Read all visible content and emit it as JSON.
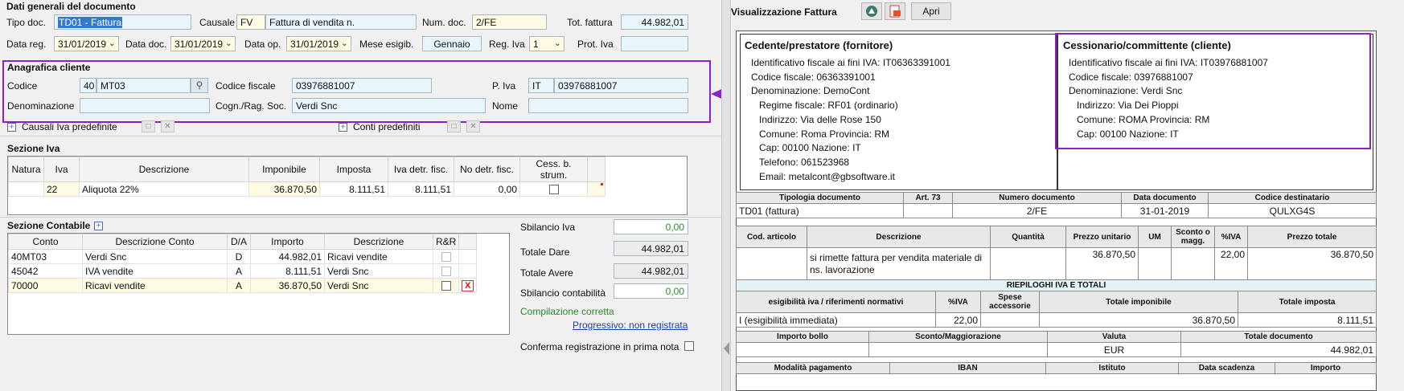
{
  "header": {
    "section_title": "Dati generali del documento",
    "tipo_doc_label": "Tipo doc.",
    "tipo_doc_value": "TD01 - Fattura",
    "causale_label": "Causale",
    "causale_code": "FV",
    "causale_desc": "Fattura di vendita n.",
    "num_doc_label": "Num. doc.",
    "num_doc_value": "2/FE",
    "tot_fattura_label": "Tot. fattura",
    "tot_fattura_value": "44.982,01",
    "data_reg_label": "Data reg.",
    "data_reg_value": "31/01/2019",
    "data_doc_label": "Data doc.",
    "data_doc_value": "31/01/2019",
    "data_op_label": "Data op.",
    "data_op_value": "31/01/2019",
    "mese_esigib_label": "Mese esigib.",
    "mese_esigib_value": "Gennaio",
    "reg_iva_label": "Reg. Iva",
    "reg_iva_value": "1",
    "prot_iva_label": "Prot. Iva",
    "prot_iva_value": ""
  },
  "anagrafica": {
    "section_title": "Anagrafica cliente",
    "codice_label": "Codice",
    "codice_prefix": "40",
    "codice_value": "MT03",
    "codice_fiscale_label": "Codice fiscale",
    "codice_fiscale_value": "03976881007",
    "piva_label": "P. Iva",
    "piva_country": "IT",
    "piva_value": "03976881007",
    "denominazione_label": "Denominazione",
    "denominazione_value": "",
    "cognome_label": "Cogn./Rag. Soc.",
    "cognome_value": "Verdi Snc",
    "nome_label": "Nome",
    "nome_value": ""
  },
  "predefiniti": {
    "causali_iva": "Causali Iva predefinite",
    "conti": "Conti predefiniti"
  },
  "sezione_iva": {
    "title": "Sezione Iva",
    "columns": [
      "Natura",
      "Iva",
      "Descrizione",
      "Imponibile",
      "Imposta",
      "Iva detr. fisc.",
      "No detr. fisc.",
      "Cess. b. strum."
    ],
    "rows": [
      {
        "natura": "",
        "iva": "22",
        "descrizione": "Aliquota 22%",
        "imponibile": "36.870,50",
        "imposta": "8.111,51",
        "iva_detr": "8.111,51",
        "no_detr": "0,00"
      }
    ]
  },
  "sezione_contabile": {
    "title": "Sezione Contabile",
    "columns": [
      "Conto",
      "Descrizione Conto",
      "D/A",
      "Importo",
      "Descrizione",
      "R&R"
    ],
    "rows": [
      {
        "conto": "40MT03",
        "descrizione_conto": "Verdi Snc",
        "da": "D",
        "importo": "44.982,01",
        "descrizione": "Ricavi vendite"
      },
      {
        "conto": "45042",
        "descrizione_conto": "IVA vendite",
        "da": "A",
        "importo": "8.111,51",
        "descrizione": "Verdi Snc"
      },
      {
        "conto": "70000",
        "descrizione_conto": "Ricavi vendite",
        "da": "A",
        "importo": "36.870,50",
        "descrizione": "Verdi Snc"
      }
    ],
    "delete_label": "X"
  },
  "totali": {
    "sbilancio_iva_label": "Sbilancio Iva",
    "sbilancio_iva_value": "0,00",
    "totale_dare_label": "Totale Dare",
    "totale_dare_value": "44.982,01",
    "totale_avere_label": "Totale Avere",
    "totale_avere_value": "44.982,01",
    "sbilancio_contabilita_label": "Sbilancio contabilità",
    "sbilancio_contabilita_value": "0,00",
    "compilazione_text": "Compilazione corretta",
    "progressivo_link": "Progressivo: non registrata",
    "conferma_label": "Conferma registrazione in prima nota"
  },
  "viewer": {
    "title": "Visualizzazione Fattura",
    "apri_label": "Apri"
  },
  "fattura": {
    "cedente": {
      "title": "Cedente/prestatore (fornitore)",
      "lines": [
        "Identificativo fiscale ai fini IVA: IT06363391001",
        "Codice fiscale: 06363391001",
        "Denominazione: DemoCont"
      ],
      "sub_lines": [
        "Regime fiscale: RF01 (ordinario)",
        "Indirizzo: Via delle Rose 150",
        "Comune: Roma Provincia: RM",
        "Cap: 00100 Nazione: IT",
        "Telefono: 061523968",
        "Email: metalcont@gbsoftware.it"
      ]
    },
    "cessionario": {
      "title": "Cessionario/committente (cliente)",
      "lines": [
        "Identificativo fiscale ai fini IVA: IT03976881007",
        "Codice fiscale: 03976881007",
        "Denominazione: Verdi Snc"
      ],
      "sub_lines": [
        "Indirizzo: Via Dei Pioppi",
        "Comune: ROMA Provincia: RM",
        "Cap: 00100 Nazione: IT"
      ]
    },
    "doc_table": {
      "headers": [
        "Tipologia documento",
        "Art. 73",
        "Numero documento",
        "Data documento",
        "Codice destinatario"
      ],
      "values": [
        "TD01 (fattura)",
        "",
        "2/FE",
        "31-01-2019",
        "QULXG4S"
      ]
    },
    "righe_table": {
      "headers": [
        "Cod. articolo",
        "Descrizione",
        "Quantità",
        "Prezzo unitario",
        "UM",
        "Sconto o magg.",
        "%IVA",
        "Prezzo totale"
      ],
      "values": [
        "",
        "si rimette fattura per vendita materiale di ns. lavorazione",
        "",
        "36.870,50",
        "",
        "",
        "22,00",
        "36.870,50"
      ]
    },
    "riepiloghi": {
      "title": "RIEPILOGHI IVA E TOTALI",
      "headers": [
        "esigibilità iva / riferimenti normativi",
        "%IVA",
        "Spese accessorie",
        "Totale imponibile",
        "Totale imposta"
      ],
      "values": [
        "I (esigibilità immediata)",
        "22,00",
        "",
        "36.870,50",
        "8.111,51"
      ]
    },
    "bollo": {
      "headers": [
        "Importo bollo",
        "Sconto/Maggiorazione",
        "Valuta",
        "Totale documento"
      ],
      "values": [
        "",
        "",
        "EUR",
        "44.982,01"
      ]
    },
    "pagamento": {
      "headers": [
        "Modalità pagamento",
        "IBAN",
        "Istituto",
        "Data scadenza",
        "Importo"
      ]
    }
  }
}
